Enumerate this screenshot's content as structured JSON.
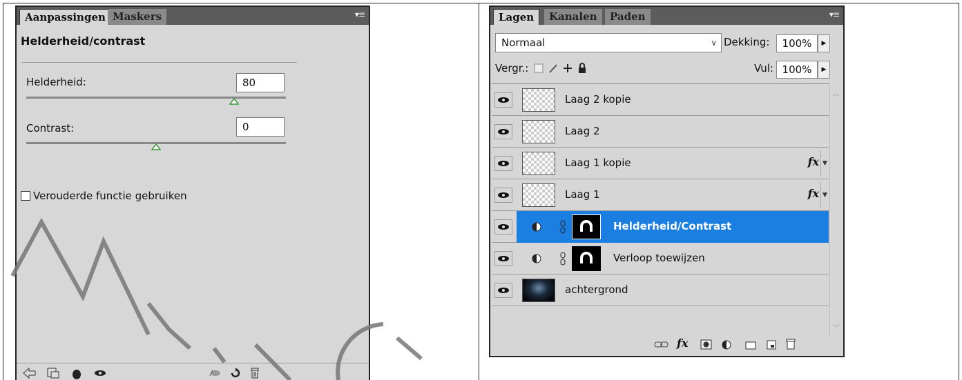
{
  "adjustments_panel": {
    "tabs": [
      {
        "label": "Aanpassingen",
        "active": true
      },
      {
        "label": "Maskers",
        "active": false
      }
    ],
    "title": "Helderheid/contrast",
    "brightness": {
      "label": "Helderheid:",
      "value": "80",
      "slider_fraction": 0.8
    },
    "contrast": {
      "label": "Contrast:",
      "value": "0",
      "slider_fraction": 0.5
    },
    "legacy_checkbox": {
      "label": "Verouderde functie gebruiken",
      "checked": false
    }
  },
  "layers_panel": {
    "tabs": [
      {
        "label": "Lagen",
        "active": true
      },
      {
        "label": "Kanalen",
        "active": false
      },
      {
        "label": "Paden",
        "active": false
      }
    ],
    "blend_mode": "Normaal",
    "opacity_label": "Dekking:",
    "opacity_value": "100%",
    "lock_label": "Vergr.:",
    "fill_label": "Vul:",
    "fill_value": "100%",
    "layers": [
      {
        "name": "Laag 2 kopie",
        "type": "pixel",
        "fx": false,
        "selected": false
      },
      {
        "name": "Laag 2",
        "type": "pixel",
        "fx": false,
        "selected": false
      },
      {
        "name": "Laag 1 kopie",
        "type": "pixel",
        "fx": true,
        "selected": false
      },
      {
        "name": "Laag 1",
        "type": "pixel",
        "fx": true,
        "selected": false
      },
      {
        "name": "Helderheid/Contrast",
        "type": "adjustment",
        "fx": false,
        "selected": true
      },
      {
        "name": "Verloop toewijzen",
        "type": "adjustment",
        "fx": false,
        "selected": false
      },
      {
        "name": "achtergrond",
        "type": "image",
        "fx": false,
        "selected": false
      }
    ],
    "fx_label": "fx"
  },
  "colors": {
    "selection": "#1a7fe0",
    "panel_bg": "#d7d7d7",
    "tab_bar": "#5c5c5c",
    "slider_thumb": "#3a9a3a"
  }
}
